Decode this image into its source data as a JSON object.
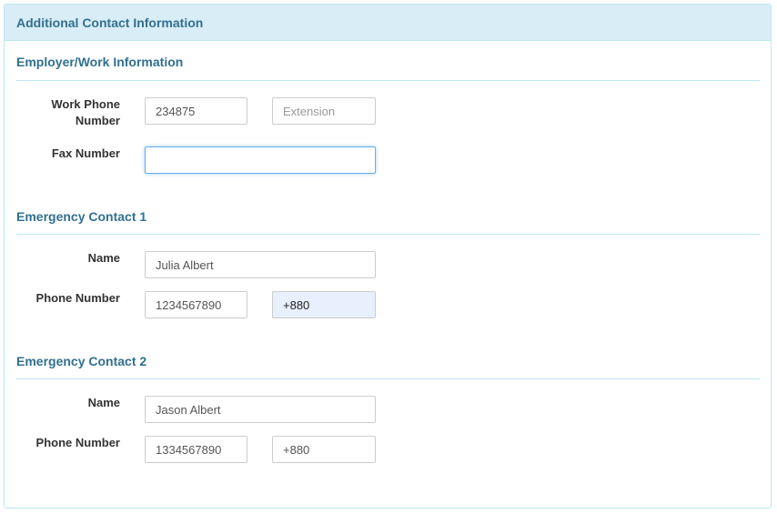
{
  "panel": {
    "heading": "Additional Contact Information"
  },
  "employer": {
    "title": "Employer/Work Information",
    "work_phone_label": "Work Phone Number",
    "work_phone_value": "234875",
    "extension_placeholder": "Extension",
    "extension_value": "",
    "fax_label": "Fax Number",
    "fax_value": ""
  },
  "emergency1": {
    "title": "Emergency Contact 1",
    "name_label": "Name",
    "name_value": "Julia Albert",
    "phone_label": "Phone Number",
    "phone_value": "1234567890",
    "country_code_value": "+880"
  },
  "emergency2": {
    "title": "Emergency Contact 2",
    "name_label": "Name",
    "name_value": "Jason Albert",
    "phone_label": "Phone Number",
    "phone_value": "1334567890",
    "country_code_value": "+880"
  },
  "colors": {
    "heading_bg": "#d9edf7",
    "heading_text": "#31708f",
    "border": "#bce8f1",
    "focus_border": "#66afe9",
    "autofill_bg": "#e8f0fe"
  }
}
